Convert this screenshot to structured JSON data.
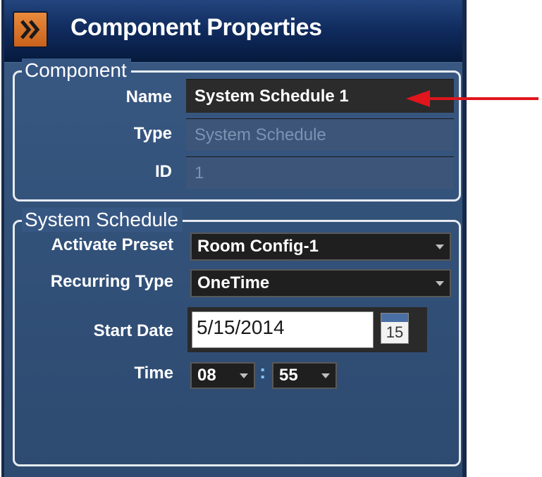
{
  "header": {
    "title": "Component Properties",
    "expand_icon": "double-chevron-right-icon"
  },
  "component_group": {
    "legend": "Component",
    "name_label": "Name",
    "name_value": "System Schedule 1",
    "type_label": "Type",
    "type_value": "System Schedule",
    "id_label": "ID",
    "id_value": "1"
  },
  "schedule_group": {
    "legend": "System Schedule",
    "activate_preset_label": "Activate Preset",
    "activate_preset_value": "Room Config-1",
    "recurring_type_label": "Recurring Type",
    "recurring_type_value": "OneTime",
    "start_date_label": "Start Date",
    "start_date_value": "5/15/2014",
    "calendar_day": "15",
    "time_label": "Time",
    "hour_value": "08",
    "time_separator": ":",
    "minute_value": "55"
  },
  "colors": {
    "panel_bg": "#375783",
    "header_bg": "#0f2a5c",
    "accent_orange": "#d9711f",
    "annotation_arrow": "#e0161c"
  }
}
